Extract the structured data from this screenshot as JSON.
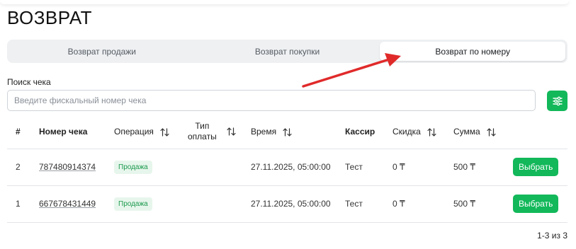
{
  "page": {
    "title": "ВОЗВРАТ"
  },
  "tabs": [
    {
      "label": "Возврат продажи",
      "active": false
    },
    {
      "label": "Возврат покупки",
      "active": false
    },
    {
      "label": "Возврат по номеру",
      "active": true
    }
  ],
  "search": {
    "label": "Поиск чека",
    "placeholder": "Введите фискальный номер чека",
    "value": ""
  },
  "filter_icon": "sliders-icon",
  "table": {
    "headers": {
      "index": "#",
      "number": "Номер чека",
      "operation": "Операция",
      "payment_type_1": "Тип",
      "payment_type_2": "оплаты",
      "time": "Время",
      "cashier": "Кассир",
      "discount": "Скидка",
      "sum": "Сумма"
    },
    "rows": [
      {
        "index": "2",
        "number": "787480914374",
        "operation": "Продажа",
        "payment_type": "",
        "time": "27.11.2025, 05:00:00",
        "cashier": "Тест",
        "discount": "0 ₸",
        "sum": "500 ₸",
        "action": "Выбрать"
      },
      {
        "index": "1",
        "number": "667678431449",
        "operation": "Продажа",
        "payment_type": "",
        "time": "27.11.2025, 05:00:00",
        "cashier": "Тест",
        "discount": "0 ₸",
        "sum": "500 ₸",
        "action": "Выбрать"
      }
    ]
  },
  "pagination": {
    "text": "1-3 из 3"
  },
  "colors": {
    "accent": "#12b85a",
    "badge_bg": "#e7f6ec",
    "badge_text": "#1d9a4f",
    "annotation_arrow": "#e02a2a"
  }
}
